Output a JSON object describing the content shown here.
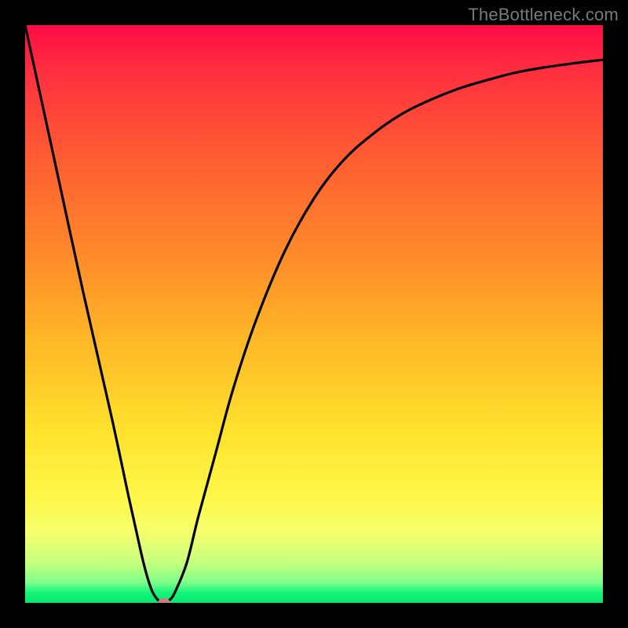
{
  "watermark": "TheBottleneck.com",
  "chart_data": {
    "type": "line",
    "title": "",
    "xlabel": "",
    "ylabel": "",
    "xlim": [
      0,
      100
    ],
    "ylim": [
      0,
      100
    ],
    "series": [
      {
        "name": "curve",
        "x": [
          0,
          5,
          10,
          15,
          18,
          20,
          21,
          22,
          23,
          24,
          25,
          26,
          28,
          30,
          33,
          36,
          40,
          45,
          50,
          55,
          60,
          65,
          70,
          75,
          80,
          85,
          90,
          95,
          100
        ],
        "values": [
          100,
          77,
          54,
          32,
          18,
          9,
          5,
          2,
          0.5,
          0,
          0.5,
          2,
          7,
          15,
          26,
          37,
          49,
          61,
          70,
          76.5,
          81,
          84.5,
          87,
          89,
          90.5,
          91.8,
          92.7,
          93.4,
          94
        ]
      }
    ],
    "marker": {
      "x": 24,
      "y": 0,
      "color": "#cf7b7b"
    },
    "background_gradient": {
      "top": "#ff0b45",
      "middle": "#ffe12d",
      "bottom": "#09e76f"
    }
  }
}
